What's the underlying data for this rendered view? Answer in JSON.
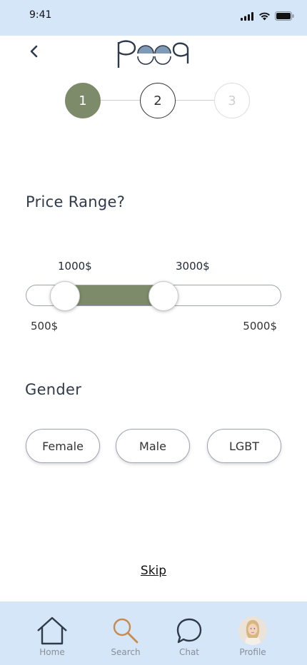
{
  "status_bar": {
    "time": "9:41"
  },
  "header": {
    "logo_icon": "poon-logo",
    "back_icon": "chevron-left-icon"
  },
  "stepper": {
    "steps": [
      "1",
      "2",
      "3"
    ],
    "active_step": 1
  },
  "price": {
    "title": "Price Range?",
    "min_selected": "1000$",
    "max_selected": "3000$",
    "range_min": "500$",
    "range_max": "5000$",
    "min_value": 1000,
    "max_value": 3000,
    "lower_bound": 500,
    "upper_bound": 5000
  },
  "gender": {
    "title": "Gender",
    "options": [
      "Female",
      "Male",
      "LGBT"
    ]
  },
  "skip_label": "Skip",
  "tabs": [
    {
      "label": "Home",
      "icon": "home-icon"
    },
    {
      "label": "Search",
      "icon": "search-icon"
    },
    {
      "label": "Chat",
      "icon": "chat-icon"
    },
    {
      "label": "Profile",
      "icon": "avatar"
    }
  ],
  "colors": {
    "accent": "#7e8b6a",
    "tab_bar": "#d4e6f7",
    "search_tab": "#c98a4e"
  }
}
